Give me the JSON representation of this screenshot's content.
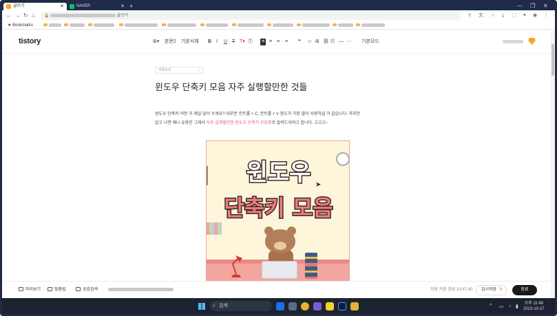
{
  "browser": {
    "tabs": [
      {
        "label": "글쓰기",
        "active": true,
        "favicon_color": "#f5a623"
      },
      {
        "label": "NAVER",
        "active": false,
        "favicon_color": "#03c75a"
      }
    ],
    "address": {
      "suffix": "글쓰기"
    },
    "bookmarks": {
      "label": "Bookmarks"
    }
  },
  "editor": {
    "logo": "tistory",
    "toolbar": {
      "paragraph": "본문2",
      "font": "기본서체",
      "bold": "B",
      "italic": "I",
      "underline": "U",
      "strike": "T",
      "mode": "기본모드"
    },
    "category_placeholder": "카테고리",
    "title": "윈도우 단축키 모음 자주 실행할만한 것들",
    "body_line1": "윈도우 단축키 어떤 거 제일 많이 쓰세요? 대부분 컨트롤 + C, 컨트롤 + V 정도가 가장 많이 사용하실 거 같습니다. 하지만",
    "body_line2_pre": "알고 나면 꽤나 유용한 그래서 ",
    "body_line2_highlight": "자주 실행할만한 윈도우 단축키 모음",
    "body_line2_post": "으로 알려드리려고 합니다. 고고고~",
    "image": {
      "text_line1": "윈도우",
      "text_line2": "단축키 모음"
    }
  },
  "footer": {
    "preview": "미리보기",
    "spellcheck": "맞춤법",
    "spacing": "공감검색",
    "autosave": "자동 저장 완료 23:47:40",
    "tempsave": "임시저장",
    "tempsave_count": "0",
    "done": "완료"
  },
  "taskbar": {
    "search": "검색",
    "time": "오후 11:48",
    "date": "2023-10-27"
  },
  "colors": {
    "accent": "#ee5a6f",
    "done_button": "#1a1a1a",
    "taskbar": "#1c2230"
  }
}
